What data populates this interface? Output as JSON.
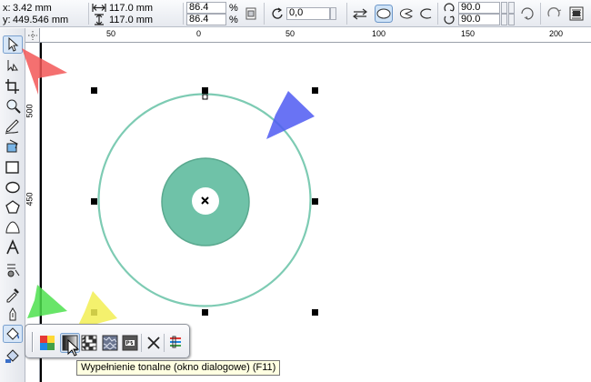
{
  "property_bar": {
    "x_label": "x:",
    "x_value": "3.42 mm",
    "y_label": "y:",
    "y_value": "449.546 mm",
    "width_value": "117.0 mm",
    "height_value": "117.0 mm",
    "scale_x": "86.4",
    "scale_y": "86.4",
    "percent_x": "%",
    "percent_y": "%",
    "rotation_value": "0,0",
    "start_angle": "90.0",
    "end_angle": "90.0"
  },
  "rulers": {
    "horizontal": [
      "50",
      "0",
      "50",
      "100",
      "150",
      "200"
    ],
    "vertical": [
      "500",
      "450"
    ]
  },
  "tooltip": {
    "text": "Wypełnienie tonalne (okno dialogowe) (F11)"
  },
  "colors": {
    "ellipse_outline": "#7dcbb3",
    "disc_fill": "#6fc2a8",
    "marker_red": "#f25757",
    "marker_blue": "#4f5bf2",
    "marker_green": "#4ee04e",
    "marker_yellow": "#f2ef53"
  }
}
